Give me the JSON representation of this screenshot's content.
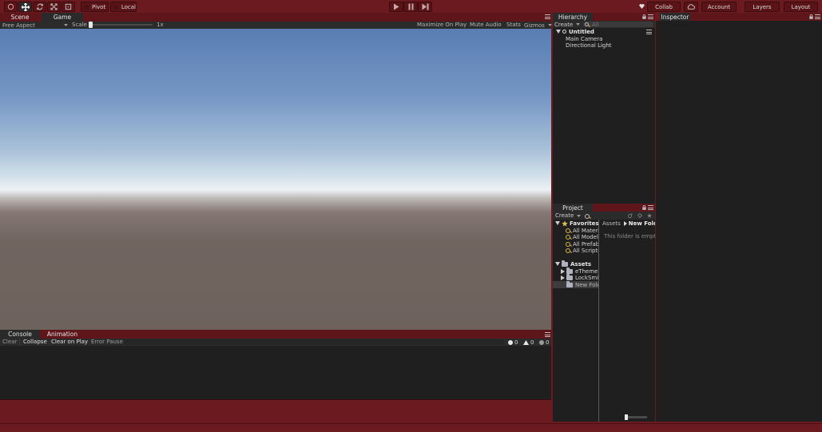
{
  "toolbar": {
    "pivot_label": "Pivot",
    "local_label": "Local",
    "collab_label": "Collab",
    "account_label": "Account",
    "layers_label": "Layers",
    "layout_label": "Layout"
  },
  "game_view": {
    "tabs": [
      "Scene",
      "Game"
    ],
    "aspect": "Free Aspect",
    "scale_label": "Scale",
    "scale_value": "1x",
    "options": [
      "Maximize On Play",
      "Mute Audio",
      "Stats",
      "Gizmos"
    ]
  },
  "hierarchy": {
    "title": "Hierarchy",
    "create_label": "Create",
    "search_placeholder": "All",
    "scene_name": "Untitled",
    "items": [
      "Main Camera",
      "Directional Light"
    ]
  },
  "inspector": {
    "title": "Inspector"
  },
  "project": {
    "title": "Project",
    "create_label": "Create",
    "favorites_label": "Favorites",
    "favorites": [
      "All Materi",
      "All Models",
      "All Prefab",
      "All Scripts"
    ],
    "assets_label": "Assets",
    "assets": [
      "eThemes",
      "LockSmith",
      "New Folde"
    ],
    "breadcrumb_root": "Assets",
    "breadcrumb_current": "New Folder",
    "empty_message": "This folder is empty"
  },
  "console": {
    "tabs": [
      "Console",
      "Animation"
    ],
    "buttons": [
      "Clear",
      "Collapse",
      "Clear on Play",
      "Error Pause"
    ],
    "info_count": "0",
    "warning_count": "0",
    "error_count": "0"
  },
  "colors": {
    "theme_background": "#6b1a1f",
    "panel_dark": "#1f1f1f",
    "sky_top": "#5a7db2",
    "horizon": "#e9eef2",
    "ground": "#6e625d"
  }
}
